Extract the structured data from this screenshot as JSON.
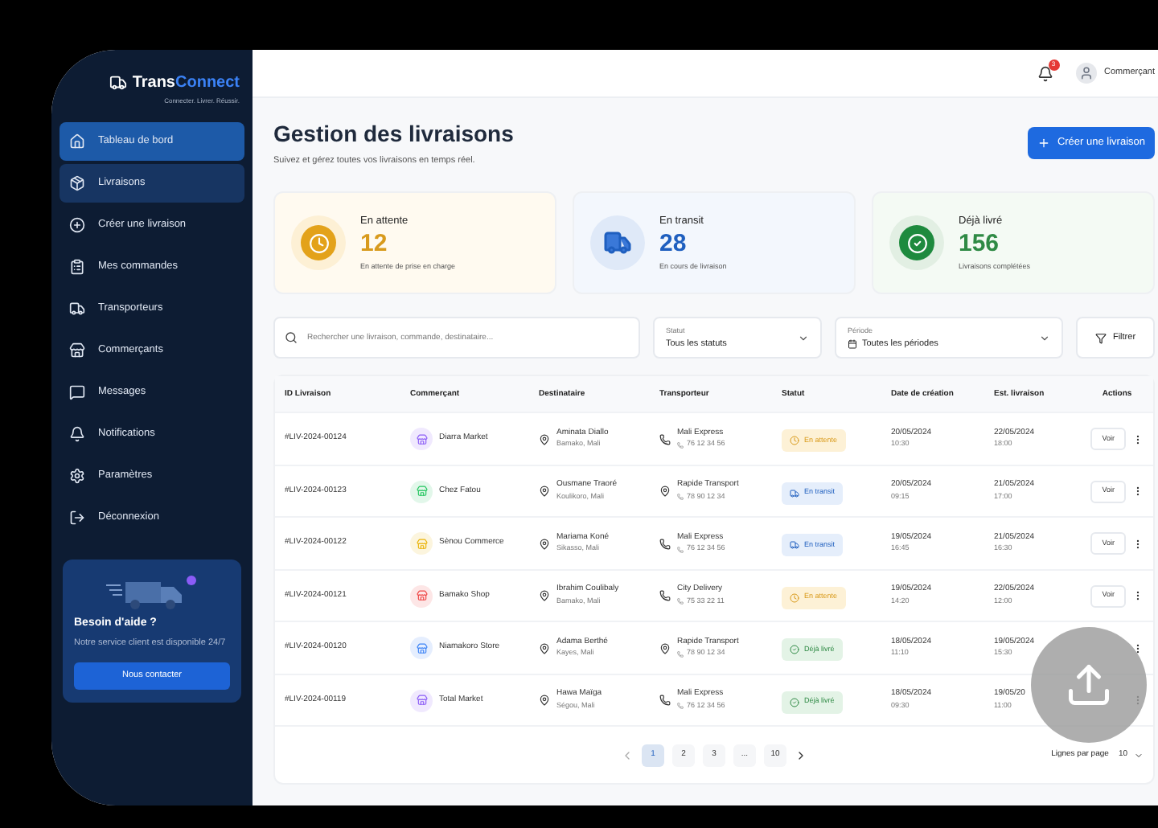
{
  "brand": {
    "name_a": "Trans",
    "name_b": "Connect",
    "tagline": "Connecter. Livrer. Réussir."
  },
  "sidebar": {
    "items": [
      {
        "label": "Tableau de bord",
        "selected": true,
        "hovered": false
      },
      {
        "label": "Livraisons",
        "selected": false,
        "hovered": true
      },
      {
        "label": "Créer une livraison",
        "selected": false,
        "hovered": false
      },
      {
        "label": "Mes commandes",
        "selected": false,
        "hovered": false
      },
      {
        "label": "Transporteurs",
        "selected": false,
        "hovered": false
      },
      {
        "label": "Commerçants",
        "selected": false,
        "hovered": false
      },
      {
        "label": "Messages",
        "selected": false,
        "hovered": false
      },
      {
        "label": "Notifications",
        "selected": false,
        "hovered": false
      },
      {
        "label": "Paramètres",
        "selected": false,
        "hovered": false
      },
      {
        "label": "Déconnexion",
        "selected": false,
        "hovered": false
      }
    ],
    "help": {
      "title": "Besoin d'aide ?",
      "text": "Notre service client est disponible 24/7",
      "button": "Nous contacter"
    }
  },
  "header": {
    "notifications": "3",
    "user": "Commerçant"
  },
  "page": {
    "title": "Gestion des livraisons",
    "subtitle": "Suivez et gérez toutes vos livraisons en temps réel.",
    "create_button": "Créer une livraison"
  },
  "stats": [
    {
      "kind": "pending",
      "label": "En attente",
      "value": "12",
      "caption": "En attente de prise en charge"
    },
    {
      "kind": "transit",
      "label": "En transit",
      "value": "28",
      "caption": "En cours de livraison"
    },
    {
      "kind": "delivered",
      "label": "Déjà livré",
      "value": "156",
      "caption": "Livraisons complétées"
    }
  ],
  "filters": {
    "search_placeholder": "Rechercher une livraison, commande, destinataire...",
    "status_label": "Statut",
    "status_value": "Tous les statuts",
    "period_label": "Période",
    "period_value": "Toutes les périodes",
    "filter_button": "Filtrer"
  },
  "table": {
    "columns": [
      "ID Livraison",
      "Commerçant",
      "Destinataire",
      "Transporteur",
      "Statut",
      "Date de création",
      "Est. livraison",
      "Actions"
    ],
    "rows": [
      {
        "id": "#LIV-2024-00124",
        "merchant": "Diarra Market",
        "color": "#8b5cf6",
        "recipient": "Aminata Diallo",
        "city": "Bamako, Mali",
        "carrier": "Mali Express",
        "kind": "phone",
        "phone": "76 12 34 56",
        "status": {
          "kind": "pending",
          "label": "En attente"
        },
        "created": "20/05/2024",
        "created_time": "10:30",
        "est": "22/05/2024",
        "est_time": "18:00",
        "action": "Voir"
      },
      {
        "id": "#LIV-2024-00123",
        "merchant": "Chez Fatou",
        "color": "#22c55e",
        "recipient": "Ousmane Traoré",
        "city": "Koulikoro, Mali",
        "carrier": "Rapide Transport",
        "kind": "pin",
        "phone": "78 90 12 34",
        "status": {
          "kind": "transit",
          "label": "En transit"
        },
        "created": "20/05/2024",
        "created_time": "09:15",
        "est": "21/05/2024",
        "est_time": "17:00",
        "action": "Voir"
      },
      {
        "id": "#LIV-2024-00122",
        "merchant": "Sènou Commerce",
        "color": "#eab308",
        "recipient": "Mariama Koné",
        "city": "Sikasso, Mali",
        "carrier": "Mali Express",
        "kind": "phone",
        "phone": "76 12 34 56",
        "status": {
          "kind": "transit",
          "label": "En transit"
        },
        "created": "19/05/2024",
        "created_time": "16:45",
        "est": "21/05/2024",
        "est_time": "16:30",
        "action": "Voir"
      },
      {
        "id": "#LIV-2024-00121",
        "merchant": "Bamako Shop",
        "color": "#ef4444",
        "recipient": "Ibrahim Coulibaly",
        "city": "Bamako, Mali",
        "carrier": "City Delivery",
        "kind": "phone",
        "phone": "75 33 22 11",
        "status": {
          "kind": "pending",
          "label": "En attente"
        },
        "created": "19/05/2024",
        "created_time": "14:20",
        "est": "22/05/2024",
        "est_time": "12:00",
        "action": "Voir"
      },
      {
        "id": "#LIV-2024-00120",
        "merchant": "Niamakoro Store",
        "color": "#3b82f6",
        "recipient": "Adama Berthé",
        "city": "Kayes, Mali",
        "carrier": "Rapide Transport",
        "kind": "pin",
        "phone": "78 90 12 34",
        "status": {
          "kind": "delivered",
          "label": "Déjà livré"
        },
        "created": "18/05/2024",
        "created_time": "11:10",
        "est": "19/05/2024",
        "est_time": "15:30"
      },
      {
        "id": "#LIV-2024-00119",
        "merchant": "Total Market",
        "color": "#8b5cf6",
        "recipient": "Hawa Maïga",
        "city": "Ségou, Mali",
        "carrier": "Mali Express",
        "kind": "phone",
        "phone": "76 12 34 56",
        "status": {
          "kind": "delivered",
          "label": "Déjà livré"
        },
        "created": "18/05/2024",
        "created_time": "09:30",
        "est": "19/05/20",
        "est_time": "11:00"
      }
    ]
  },
  "pagination": {
    "pages": [
      {
        "label": "1",
        "selected": true
      },
      {
        "label": "2",
        "selected": false
      },
      {
        "label": "3",
        "selected": false
      },
      {
        "label": "...",
        "selected": false
      },
      {
        "label": "10",
        "selected": false
      }
    ],
    "rows_label": "Lignes par page",
    "rows_value": "10"
  }
}
